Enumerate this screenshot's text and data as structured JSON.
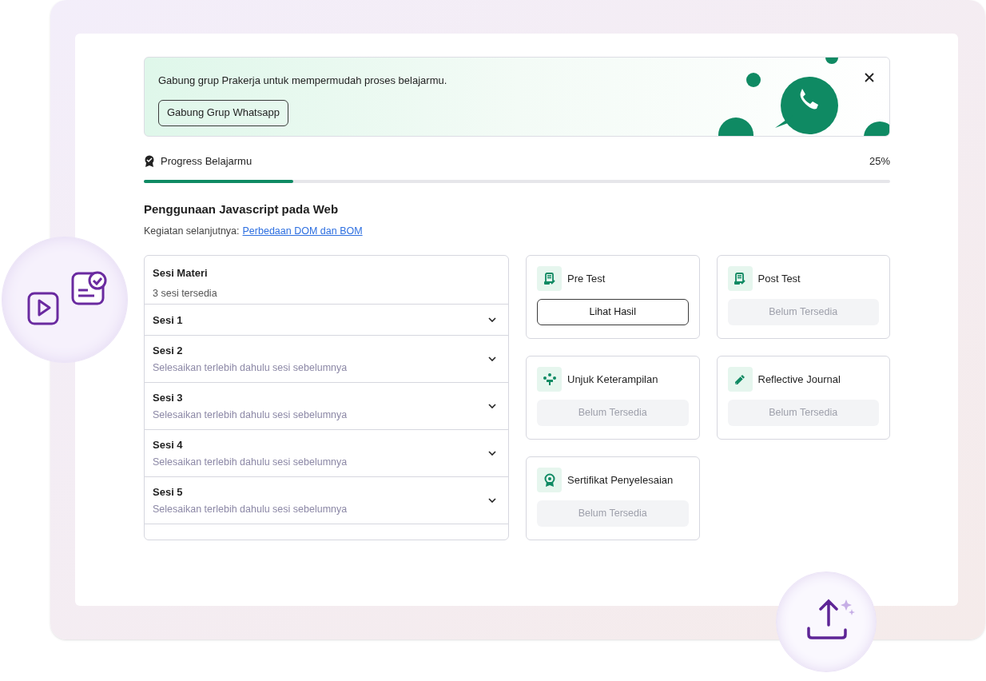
{
  "banner": {
    "message": "Gabung grup Prakerja untuk mempermudah proses belajarmu.",
    "button": "Gabung Grup Whatsapp"
  },
  "progress": {
    "label": "Progress Belajarmu",
    "reading": "25%",
    "level": 0.2
  },
  "course": {
    "title": "Penggunaan Javascript pada Web",
    "next_label": "Kegiatan selanjutnya:",
    "next_link": "Perbedaan DOM dan BOM"
  },
  "sessions": {
    "title": "Sesi Materi",
    "subtitle": "3 sesi tersedia",
    "items": [
      {
        "name": "Sesi 1"
      },
      {
        "name": "Sesi 2",
        "note": "Selesaikan terlebih dahulu sesi sebelumnya"
      },
      {
        "name": "Sesi 3",
        "note": "Selesaikan terlebih dahulu sesi sebelumnya"
      },
      {
        "name": "Sesi 4",
        "note": "Selesaikan terlebih dahulu sesi sebelumnya"
      },
      {
        "name": "Sesi 5",
        "note": "Selesaikan terlebih dahulu sesi sebelumnya"
      }
    ]
  },
  "activities": [
    {
      "kind": "test",
      "title": "Pre Test",
      "button": "Lihat Hasil",
      "available": true
    },
    {
      "kind": "test",
      "title": "Post Test",
      "button": "Belum Tersedia",
      "available": false
    },
    {
      "kind": "skill",
      "title": "Unjuk Keterampilan",
      "button": "Belum Tersedia",
      "available": false
    },
    {
      "kind": "journal",
      "title": "Reflective Journal",
      "button": "Belum Tersedia",
      "available": false
    },
    {
      "kind": "certificate",
      "title": "Sertifikat Penyelesaian",
      "button": "Belum Tersedia",
      "available": false
    }
  ]
}
